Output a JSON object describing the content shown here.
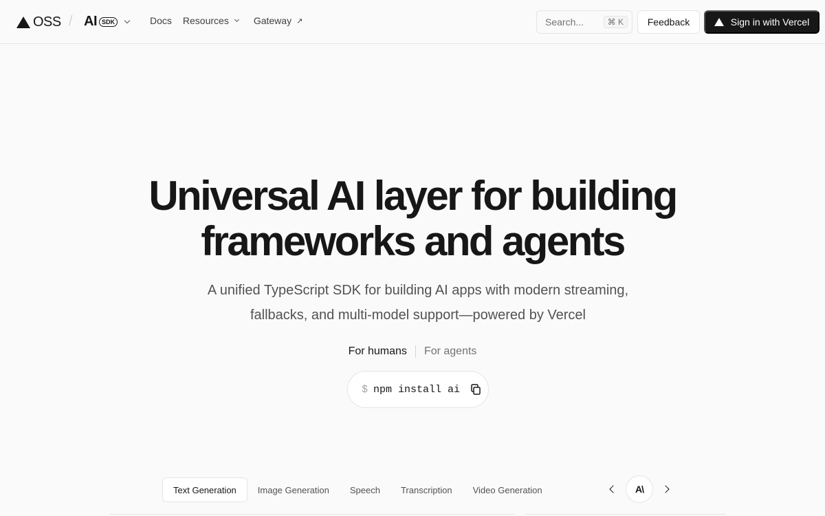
{
  "header": {
    "brand": "OSS",
    "separator": "/",
    "product": "AI",
    "product_badge": "SDK",
    "nav": {
      "docs": "Docs",
      "resources": "Resources",
      "gateway": "Gateway"
    },
    "search_placeholder": "Search...",
    "search_shortcut": "⌘ K",
    "feedback": "Feedback",
    "signin": "Sign in with Vercel"
  },
  "hero": {
    "title_line1": "Universal AI layer for building",
    "title_line2": "frameworks and agents",
    "subtitle_line1": "A unified TypeScript SDK for building AI apps with modern streaming,",
    "subtitle_line2": "fallbacks, and multi-model support—powered by Vercel",
    "mode_humans": "For humans",
    "mode_agents": "For agents",
    "install_prompt": "$",
    "install_command": "npm install ai"
  },
  "tabs": [
    "Text Generation",
    "Image Generation",
    "Speech",
    "Transcription",
    "Video Generation"
  ],
  "active_tab": "Text Generation",
  "provider_icon": "anthropic-icon",
  "colors": {
    "background": "#fafafa",
    "text": "#171717",
    "button_dark": "#171717",
    "border": "#e5e5e5"
  }
}
